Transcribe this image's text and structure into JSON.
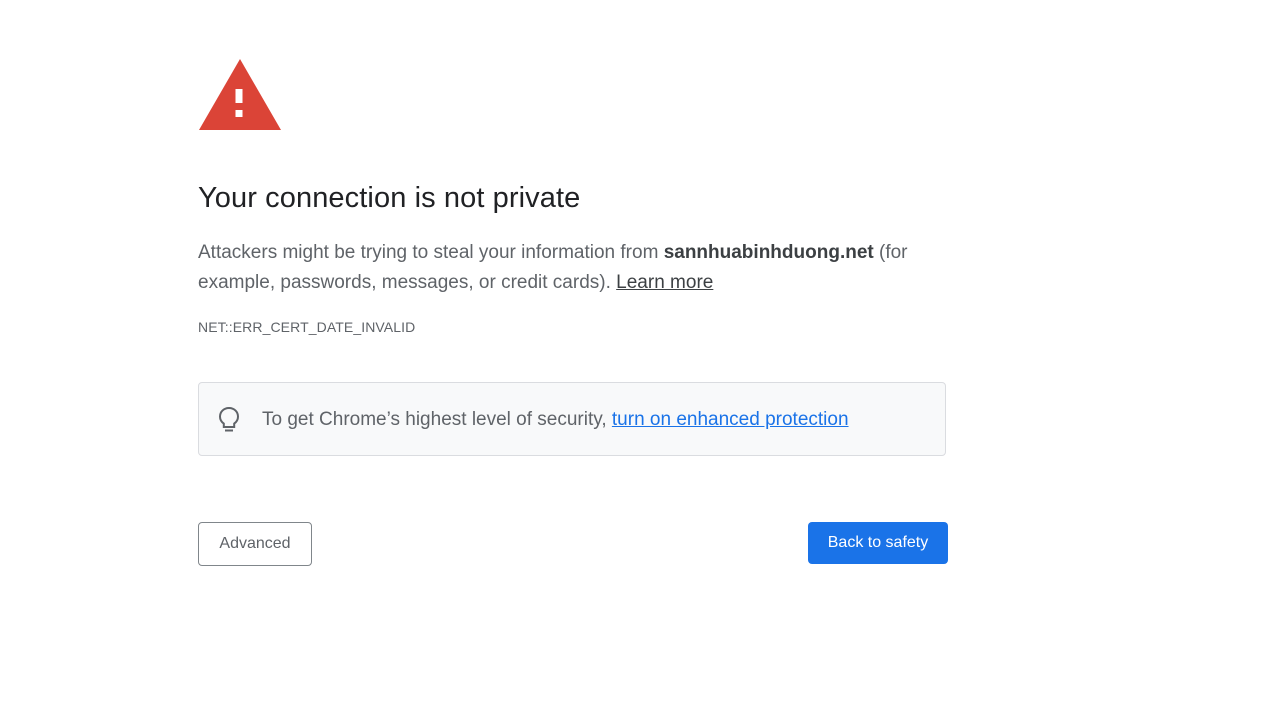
{
  "interstitial": {
    "icon": "warning-triangle-icon",
    "icon_color": "#db4437",
    "title": "Your connection is not private",
    "body_prefix": "Attackers might be trying to steal your information from ",
    "domain": "sannhuabinhduong.net",
    "body_suffix": " (for example, passwords, messages, or credit cards). ",
    "learn_more": "Learn more",
    "error_code": "NET::ERR_CERT_DATE_INVALID"
  },
  "enhanced_protection": {
    "icon": "lightbulb-icon",
    "text": "To get Chrome’s highest level of security, ",
    "link": "turn on enhanced protection"
  },
  "buttons": {
    "advanced": "Advanced",
    "back_to_safety": "Back to safety"
  },
  "colors": {
    "primary": "#1a73e8",
    "warning": "#db4437",
    "text_secondary": "#5f6368"
  }
}
